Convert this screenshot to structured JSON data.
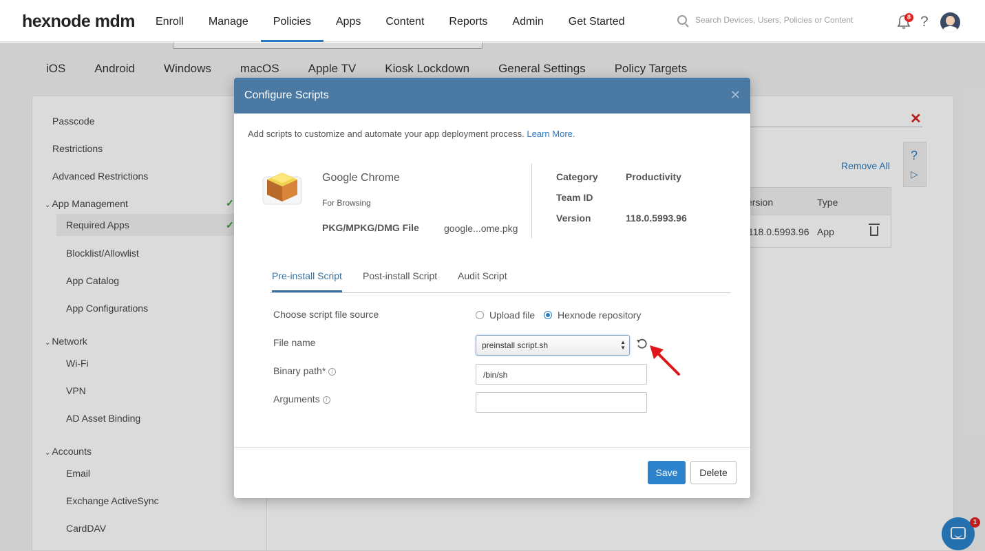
{
  "brand": {
    "logo_text": "hexnode mdm"
  },
  "nav": {
    "items": [
      {
        "label": "Enroll"
      },
      {
        "label": "Manage"
      },
      {
        "label": "Policies"
      },
      {
        "label": "Apps"
      },
      {
        "label": "Content"
      },
      {
        "label": "Reports"
      },
      {
        "label": "Admin"
      },
      {
        "label": "Get Started"
      }
    ],
    "active": "Policies",
    "search_placeholder": "Search Devices, Users, Policies or Content",
    "notification_count": "8"
  },
  "platform_tabs": [
    "iOS",
    "Android",
    "Windows",
    "macOS",
    "Apple TV",
    "Kiosk Lockdown",
    "General Settings",
    "Policy Targets"
  ],
  "sidebar": {
    "items": [
      {
        "label": "Passcode"
      },
      {
        "label": "Restrictions"
      },
      {
        "label": "Advanced Restrictions"
      },
      {
        "label": "App Management",
        "group": true,
        "checked": true
      },
      {
        "label": "Required Apps",
        "checked": true,
        "selected": true
      },
      {
        "label": "Blocklist/Allowlist"
      },
      {
        "label": "App Catalog"
      },
      {
        "label": "App Configurations"
      },
      {
        "label": "Network",
        "group": true
      },
      {
        "label": "Wi-Fi"
      },
      {
        "label": "VPN"
      },
      {
        "label": "AD Asset Binding"
      },
      {
        "label": "Accounts",
        "group": true
      },
      {
        "label": "Email"
      },
      {
        "label": "Exchange ActiveSync"
      },
      {
        "label": "CardDAV"
      }
    ]
  },
  "background_table": {
    "remove_all": "Remove All",
    "headers": [
      "ersion",
      "Type"
    ],
    "row": [
      "118.0.5993.96",
      "App"
    ]
  },
  "modal": {
    "title": "Configure Scripts",
    "intro": "Add scripts to customize and automate your app deployment process.",
    "learn_more": "Learn More.",
    "app": {
      "name": "Google Chrome",
      "subtitle": "For Browsing",
      "file_label": "PKG/MPKG/DMG File",
      "file_value": "google...ome.pkg"
    },
    "meta": {
      "category_label": "Category",
      "category_value": "Productivity",
      "team_id_label": "Team ID",
      "team_id_value": "",
      "version_label": "Version",
      "version_value": "118.0.5993.96"
    },
    "tabs": [
      "Pre-install Script",
      "Post-install Script",
      "Audit Script"
    ],
    "active_tab": "Pre-install Script",
    "form": {
      "source_label": "Choose script file source",
      "upload_label": "Upload file",
      "repo_label": "Hexnode repository",
      "selected_source": "Hexnode repository",
      "file_name_label": "File name",
      "file_name_value": "preinstall script.sh",
      "binary_path_label": "Binary path*",
      "binary_path_value": "/bin/sh",
      "arguments_label": "Arguments",
      "arguments_value": ""
    },
    "buttons": {
      "save": "Save",
      "delete": "Delete"
    }
  },
  "chat": {
    "badge": "1"
  },
  "colors": {
    "header": "#4a7aa4",
    "accent": "#2a7ac0",
    "save_button": "#2c83cc",
    "annotation_arrow": "#e0161b"
  }
}
